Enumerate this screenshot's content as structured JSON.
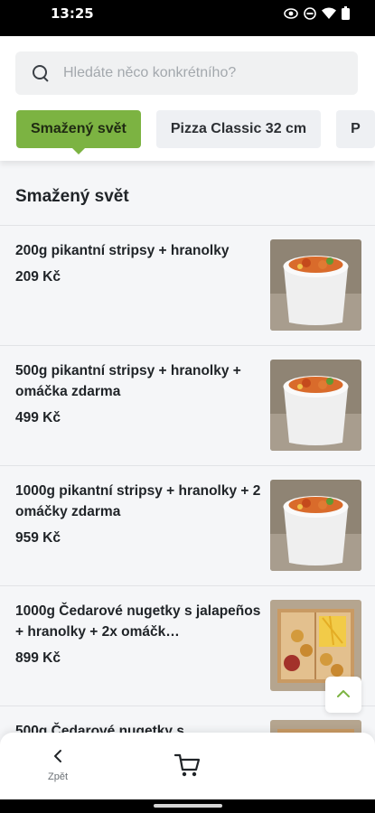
{
  "status": {
    "time": "13:25"
  },
  "search": {
    "placeholder": "Hledáte něco konkrétního?"
  },
  "tabs": [
    {
      "label": "Smažený svět",
      "active": true
    },
    {
      "label": "Pizza Classic 32 cm",
      "active": false
    },
    {
      "label": "P",
      "active": false
    }
  ],
  "section": {
    "title": "Smažený svět"
  },
  "items": [
    {
      "name": "200g pikantní stripsy + hranolky",
      "price": "209 Kč",
      "image": "strips-cup"
    },
    {
      "name": "500g pikantní stripsy + hranolky + omáčka zdarma",
      "price": "499 Kč",
      "image": "strips-cup"
    },
    {
      "name": "1000g pikantní stripsy + hranolky + 2 omáčky zdarma",
      "price": "959 Kč",
      "image": "strips-cup"
    },
    {
      "name": "1000g Čedarové nugetky s jalapeños + hranolky + 2x omáčk…",
      "price": "899 Kč",
      "image": "nuggets-box"
    },
    {
      "name": "500g Čedarové nugetky s",
      "price": "",
      "image": "nuggets-box"
    }
  ],
  "bottom": {
    "back_label": "Zpět"
  },
  "colors": {
    "accent": "#7cb342",
    "text": "#202428"
  },
  "icons": [
    "search-icon",
    "chevron-left-icon",
    "cart-icon",
    "chevron-up-icon"
  ]
}
